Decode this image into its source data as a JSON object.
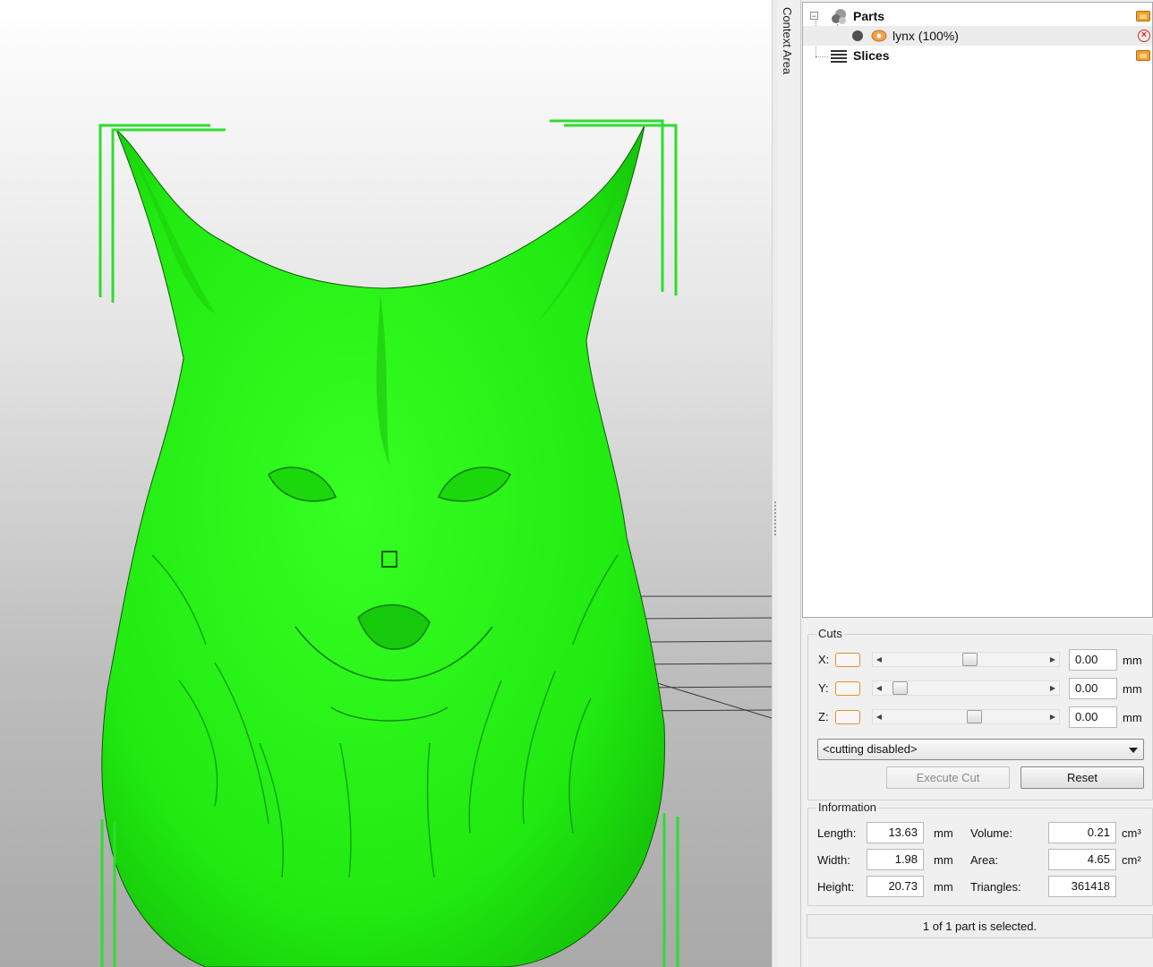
{
  "sidebar": {
    "context_tab": "Context Area",
    "tree": {
      "parts_label": "Parts",
      "part_item_label": "lynx (100%)",
      "slices_label": "Slices",
      "expander_symbol": "−"
    }
  },
  "cuts": {
    "title": "Cuts",
    "axes": [
      {
        "label": "X:",
        "value": "0.00",
        "unit": "mm",
        "slider_level": 0.53
      },
      {
        "label": "Y:",
        "value": "0.00",
        "unit": "mm",
        "slider_level": 0.05
      },
      {
        "label": "Z:",
        "value": "0.00",
        "unit": "mm",
        "slider_level": 0.56
      }
    ],
    "mode_select": "<cutting disabled>",
    "execute_label": "Execute Cut",
    "reset_label": "Reset"
  },
  "information": {
    "title": "Information",
    "length_label": "Length:",
    "length_value": "13.63",
    "length_unit": "mm",
    "width_label": "Width:",
    "width_value": "1.98",
    "width_unit": "mm",
    "height_label": "Height:",
    "height_value": "20.73",
    "height_unit": "mm",
    "volume_label": "Volume:",
    "volume_value": "0.21",
    "volume_unit": "cm³",
    "area_label": "Area:",
    "area_value": "4.65",
    "area_unit": "cm²",
    "triangles_label": "Triangles:",
    "triangles_value": "361418"
  },
  "status_text": "1 of 1 part is selected.",
  "colors": {
    "model_green": "#22ee11",
    "bbox_green": "#2fdc2f",
    "accent_orange": "#e8902a"
  }
}
